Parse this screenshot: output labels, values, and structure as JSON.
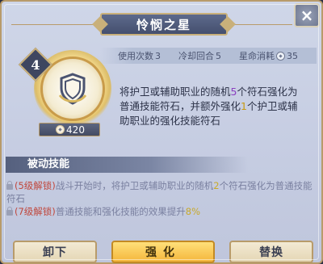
{
  "title": "怜悯之星",
  "close_icon_label": "×",
  "stats": {
    "uses_label": "使用次数",
    "uses_value": "3",
    "cooldown_label": "冷却回合",
    "cooldown_value": "5",
    "star_cost_label": "星命消耗",
    "star_cost_value": "35"
  },
  "card": {
    "level": "4",
    "cost": "420",
    "icon": "shield-icon"
  },
  "main_desc": {
    "p1": "将护卫或辅助职业的随机",
    "n1": "5",
    "p2": "个符石强化为普通技能符石，并额外强化",
    "n2": "1",
    "p3": "个护卫或辅助职业的强化技能符石"
  },
  "passive": {
    "title": "被动技能",
    "item1": {
      "tag": "(5级解锁)",
      "p1": "战斗开始时，将护卫或辅助职业的随机",
      "n1": "2",
      "p2": "个符石强化为普通技能符石"
    },
    "item2": {
      "tag": "(7级解锁)",
      "p1": "普通技能和强化技能的效果提升",
      "n1": "8%"
    }
  },
  "buttons": {
    "unload": "卸下",
    "enhance": "强化",
    "replace": "替换"
  },
  "colors": {
    "panel_bg": "#c9d0e4",
    "accent_gold": "#c9b07a",
    "highlight_purple": "#8a3fc0",
    "highlight_yellow": "#c89a12",
    "locked_red": "#c0473c"
  }
}
